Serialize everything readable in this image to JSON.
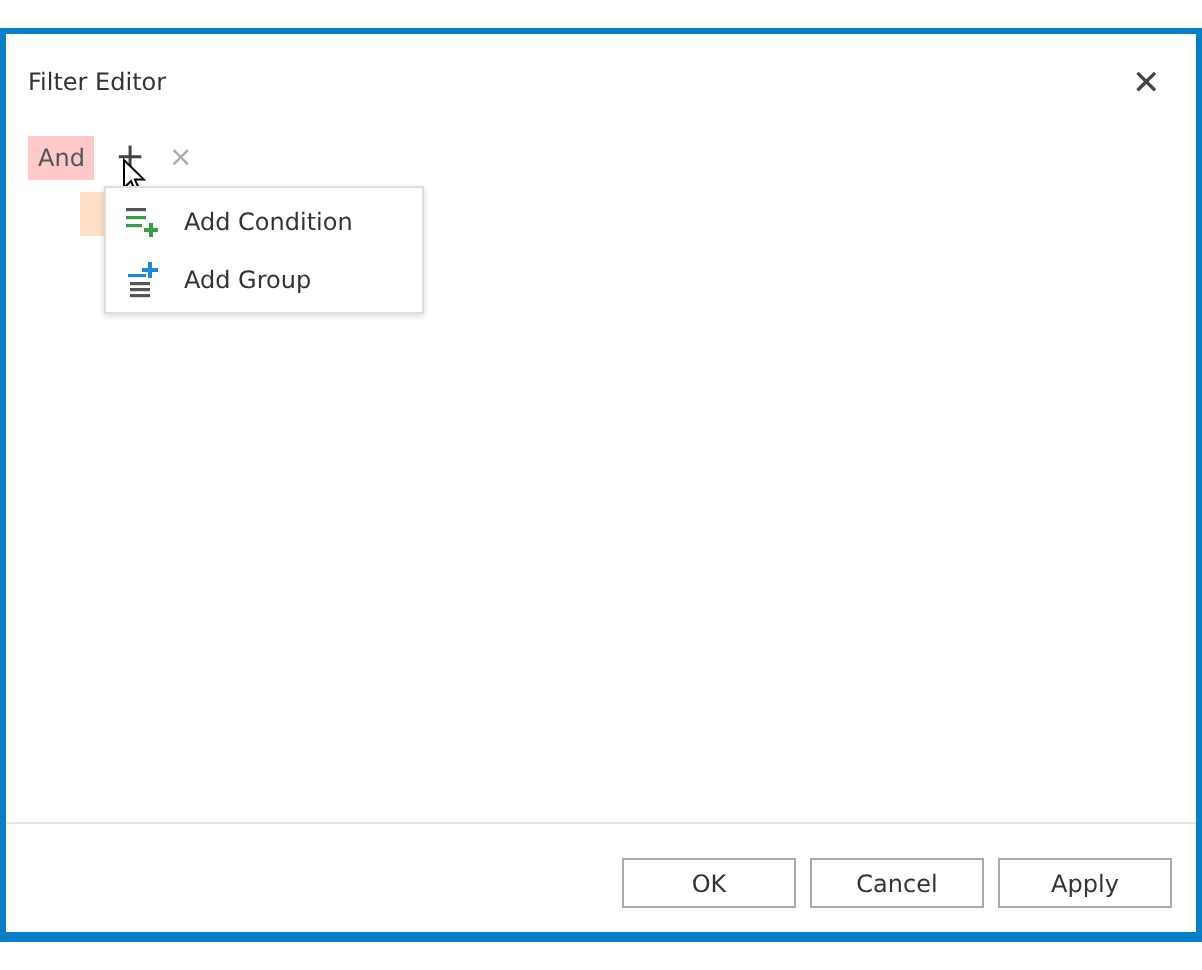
{
  "window": {
    "title": "Filter Editor",
    "close": "✕"
  },
  "root_group": {
    "operator": "And",
    "add": "+",
    "remove": "×",
    "children": [
      {
        "kind": "group"
      }
    ]
  },
  "menu": {
    "items": [
      {
        "label": "Add Condition",
        "kind": "condition"
      },
      {
        "label": "Add Group",
        "kind": "group"
      }
    ]
  },
  "buttons": [
    "OK",
    "Cancel",
    "Apply"
  ]
}
